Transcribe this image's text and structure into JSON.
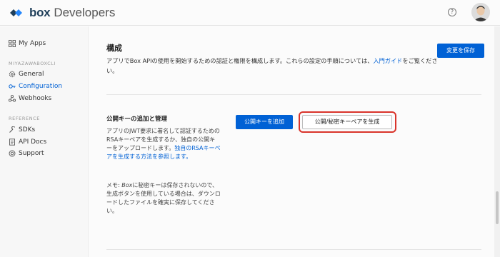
{
  "header": {
    "brand": "box",
    "product": "Developers",
    "help_glyph": "?",
    "icons": [
      "box-logo-icon",
      "help-icon",
      "user-avatar"
    ]
  },
  "sidebar": {
    "my_apps": "My Apps",
    "app_section": "MIYAZAWABOXCLI",
    "app_items": [
      {
        "label": "General",
        "icon": "gear-icon"
      },
      {
        "label": "Configuration",
        "icon": "key-icon",
        "active": true
      },
      {
        "label": "Webhooks",
        "icon": "webhook-icon"
      }
    ],
    "reference_section": "REFERENCE",
    "reference_items": [
      {
        "label": "SDKs",
        "icon": "wrench-icon"
      },
      {
        "label": "API Docs",
        "icon": "document-icon"
      },
      {
        "label": "Support",
        "icon": "support-icon"
      }
    ]
  },
  "config": {
    "title": "構成",
    "desc_before": "アプリでBox APIの使用を開始するための認証と権限を構成します。これらの設定の手順については、",
    "desc_link": "入門ガイド",
    "desc_after": "をご覧ください。",
    "save_label": "変更を保存"
  },
  "keys": {
    "title": "公開キーの追加と管理",
    "desc": "アプリのJWT要求に署名して認証するためのRSAキーペアを生成するか、独自の公開キーをアップロードします。",
    "desc_link": "独自のRSAキーペアを生成する方法を参照します。",
    "note_prefix": "メモ: ",
    "note_box": "Box",
    "note_text": "に秘密キーは保存されないので、生成ボタンを使用している場合は、ダウンロードしたファイルを確実に保存してください。",
    "add_label": "公開キーを追加",
    "generate_label": "公開/秘密キーペアを生成"
  },
  "colors": {
    "accent": "#0061d5",
    "highlight": "#d9342b",
    "brand_dark": "#1f3f5a"
  }
}
